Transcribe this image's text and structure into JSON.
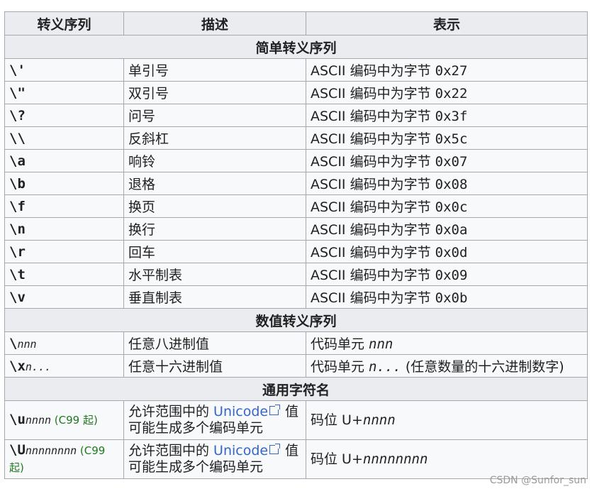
{
  "headers": [
    "转义序列",
    "描述",
    "表示"
  ],
  "sections": [
    {
      "title": "简单转义序列",
      "rows": [
        {
          "seq": "\\'",
          "desc": "单引号",
          "rep_text": "ASCII 编码中为字节 ",
          "rep_code": "0x27"
        },
        {
          "seq": "\\\"",
          "desc": "双引号",
          "rep_text": "ASCII 编码中为字节 ",
          "rep_code": "0x22"
        },
        {
          "seq": "\\?",
          "desc": "问号",
          "rep_text": "ASCII 编码中为字节 ",
          "rep_code": "0x3f"
        },
        {
          "seq": "\\\\",
          "desc": "反斜杠",
          "rep_text": "ASCII 编码中为字节 ",
          "rep_code": "0x5c"
        },
        {
          "seq": "\\a",
          "desc": "响铃",
          "rep_text": "ASCII 编码中为字节 ",
          "rep_code": "0x07"
        },
        {
          "seq": "\\b",
          "desc": "退格",
          "rep_text": "ASCII 编码中为字节 ",
          "rep_code": "0x08"
        },
        {
          "seq": "\\f",
          "desc": "换页",
          "rep_text": "ASCII 编码中为字节 ",
          "rep_code": "0x0c"
        },
        {
          "seq": "\\n",
          "desc": "换行",
          "rep_text": "ASCII 编码中为字节 ",
          "rep_code": "0x0a"
        },
        {
          "seq": "\\r",
          "desc": "回车",
          "rep_text": "ASCII 编码中为字节 ",
          "rep_code": "0x0d"
        },
        {
          "seq": "\\t",
          "desc": "水平制表",
          "rep_text": "ASCII 编码中为字节 ",
          "rep_code": "0x09"
        },
        {
          "seq": "\\v",
          "desc": "垂直制表",
          "rep_text": "ASCII 编码中为字节 ",
          "rep_code": "0x0b"
        }
      ]
    },
    {
      "title": "数值转义序列",
      "rows": [
        {
          "seq": "\\",
          "seq_var": "nnn",
          "desc": "任意八进制值",
          "rep_text": "代码单元 ",
          "rep_var": "nnn"
        },
        {
          "seq": "\\x",
          "seq_var": "n...",
          "desc": "任意十六进制值",
          "rep_text": "代码单元 ",
          "rep_var": "n...",
          "rep_suffix": " (任意数量的十六进制数字)"
        }
      ]
    },
    {
      "title": "通用字符名",
      "rows": [
        {
          "seq": "\\u",
          "seq_var": "nnnn",
          "note": " (C99 起)",
          "desc_pre": "允许范围中的 ",
          "desc_link": "Unicode",
          "desc_post": " 值可能生成多个编码单元",
          "rep_text": "码位 U+",
          "rep_var": "nnnn"
        },
        {
          "seq": "\\U",
          "seq_var": "nnnnnnnn",
          "note": " (C99 起)",
          "desc_pre": "允许范围中的 ",
          "desc_link": "Unicode",
          "desc_post": " 值可能生成多个编码单元",
          "rep_text": "码位 U+",
          "rep_var": "nnnnnnnn"
        }
      ]
    }
  ],
  "watermark": "CSDN @Sunfor_sun",
  "icons": {
    "external_link": "external-link-icon"
  },
  "colors": {
    "header_bg": "#eaecf0",
    "cell_bg": "#f8f9fa",
    "border": "#a2a9b1",
    "link": "#3366cc",
    "note": "#1f7a1f"
  }
}
